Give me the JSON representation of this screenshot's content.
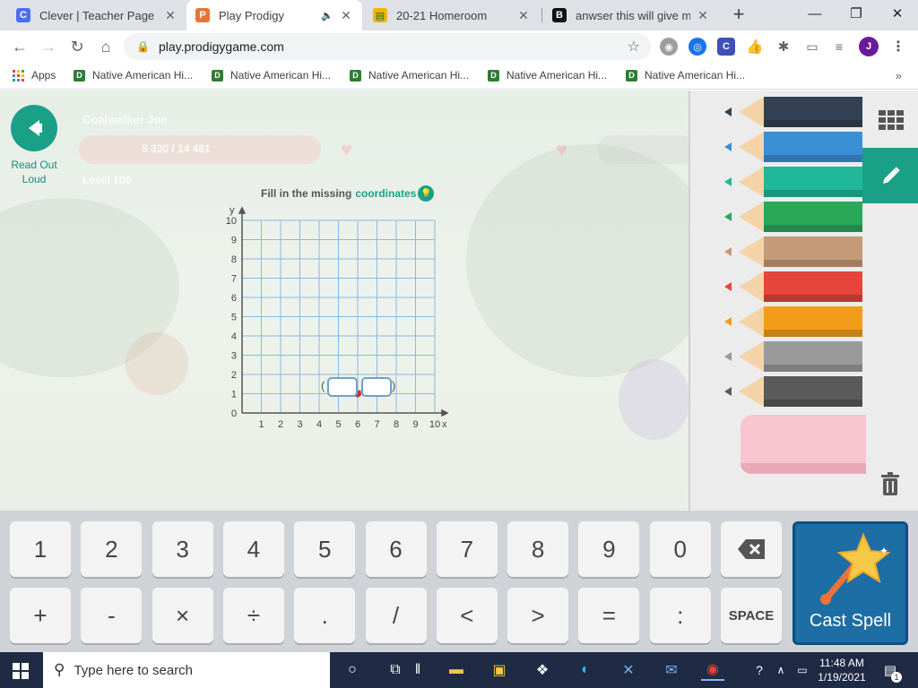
{
  "tabs": [
    {
      "title": "Clever | Teacher Page",
      "favicon_letter": "C",
      "favicon_color": "#4c6ef5"
    },
    {
      "title": "Play Prodigy",
      "favicon_letter": "P",
      "favicon_color": "#e8743b"
    },
    {
      "title": "20-21 Homeroom",
      "favicon_letter": "▤",
      "favicon_color": "#f4b400"
    },
    {
      "title": "anwser this will give my p",
      "favicon_letter": "B",
      "favicon_color": "#111111"
    }
  ],
  "address": {
    "url": "play.prodigygame.com"
  },
  "profile_initial": "J",
  "bookmarks": {
    "apps_label": "Apps",
    "items": [
      "Native American Hi...",
      "Native American Hi...",
      "Native American Hi...",
      "Native American Hi...",
      "Native American Hi..."
    ]
  },
  "game": {
    "read_out_label": "Read Out Loud",
    "player_name": "Coalwalker Joe",
    "hp_text": "5 330 / 14 481",
    "level_text": "Level 100",
    "question_prefix": "Fill in the missing",
    "question_keyword": "coordinates",
    "grid": {
      "x_axis_label": "x",
      "y_axis_label": "y",
      "origin_label": "0",
      "x_ticks": [
        "1",
        "2",
        "3",
        "4",
        "5",
        "6",
        "7",
        "8",
        "9",
        "10"
      ],
      "y_ticks": [
        "1",
        "2",
        "3",
        "4",
        "5",
        "6",
        "7",
        "8",
        "9",
        "10"
      ],
      "point": {
        "x": 6,
        "y": 1,
        "color": "#d32f2f"
      },
      "open_paren": "(",
      "comma": ",",
      "close_paren": ")"
    }
  },
  "panel": {
    "pencil_colors": [
      "#334155",
      "#3b8fd6",
      "#1fb89a",
      "#2aa85a",
      "#c49a78",
      "#e5453a",
      "#f39c1b",
      "#9a9a9a",
      "#5a5a5a"
    ],
    "active_tool_color": "#1ba088"
  },
  "keyboard": {
    "row1": [
      "1",
      "2",
      "3",
      "4",
      "5",
      "6",
      "7",
      "8",
      "9",
      "0"
    ],
    "row2": [
      "+",
      "-",
      "×",
      "÷",
      ".",
      "/",
      "<",
      ">",
      "=",
      ":"
    ],
    "space_label": "SPACE",
    "cast_label": "Cast Spell"
  },
  "taskbar": {
    "search_placeholder": "Type here to search",
    "time": "11:48 AM",
    "date": "1/19/2021",
    "notification_count": "1"
  }
}
